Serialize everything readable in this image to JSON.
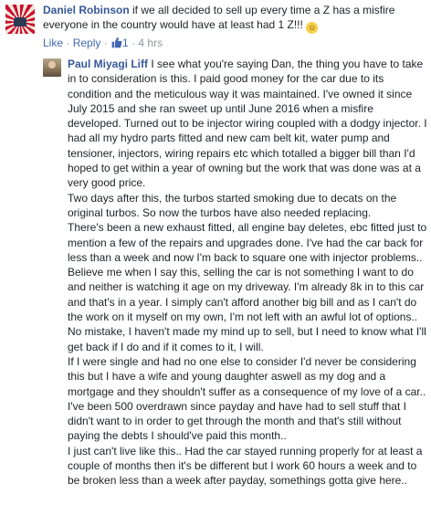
{
  "comment1": {
    "author": "Daniel Robinson",
    "text": "if we all decided to sell up every time a Z has a misfire everyone in the country would have at least had 1 Z!!!",
    "emoji": "grinning-face-emoji",
    "actions": {
      "like": "Like",
      "separator1": " · ",
      "reply": "Reply",
      "separator2": " · ",
      "like_count": "1",
      "separator3": " · ",
      "time": "4 hrs"
    }
  },
  "comment2": {
    "author": "Paul Miyagi Liff",
    "paragraphs": [
      "I see what you're saying Dan, the thing you have to take in to consideration is this. I paid good money for the car due to its condition and the meticulous way it was maintained. I've owned it since July 2015 and she ran sweet up until June 2016 when a misfire developed. Turned out to be injector wiring coupled with a dodgy injector. I had all my hydro parts fitted and new cam belt kit, water pump and tensioner, injectors, wiring repairs etc which totalled a bigger bill than I'd hoped to get within a year of owning but the work that was done was at a very good price.",
      "Two days after this, the turbos started smoking due to decats on the original turbos. So now the turbos have also needed replacing.",
      "There's been a new exhaust fitted, all engine bay deletes, ebc fitted just to mention a few of the repairs and upgrades done. I've had the car back for less than a week and now I'm back to square one with injector problems.. Believe me when I say this, selling the car is not something I want to do and neither is watching it age on my driveway. I'm already 8k in to this car and that's in a year. I simply can't afford another big bill and as I can't do the work on it myself on my own, I'm not left with an awful lot of options..",
      "No mistake, I haven't made my mind up to sell, but I need to know what I'll get back if I do and if it comes to it, I will.",
      "If I were single and had no one else to consider I'd never be considering this but I have a wife and young daughter aswell as my dog and a mortgage and they shouldn't suffer as a consequence of my love of a car..",
      "I've been 500 overdrawn since payday and have had to sell stuff that I didn't want to in order to get through the month and that's still without paying the debts I should've paid this month..",
      "I just can't live like this.. Had the car stayed running properly for at least a couple of months then it's be different but I work 60 hours a week and to be broken less than a week after payday, somethings gotta give here.."
    ]
  },
  "colors": {
    "author": "#365899",
    "link": "#4267b2",
    "meta": "#90949c",
    "text": "#1d2129"
  }
}
